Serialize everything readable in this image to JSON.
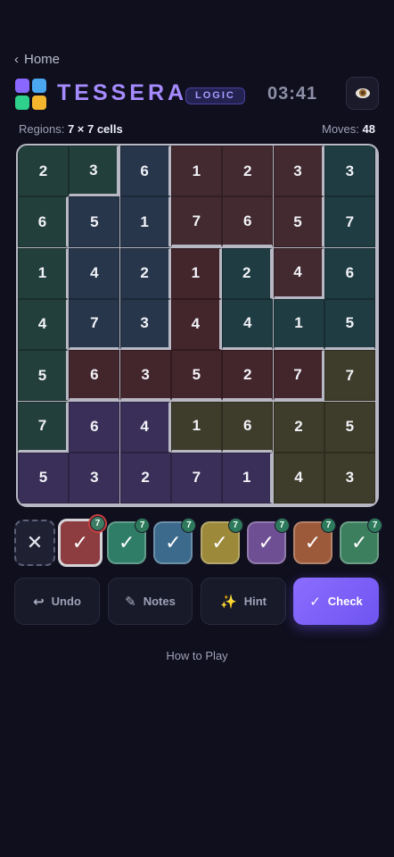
{
  "nav": {
    "back_label": "Home"
  },
  "header": {
    "title": "TESSERA",
    "badge": "LOGIC",
    "timer": "03:41"
  },
  "stats": {
    "regions_label": "Regions:",
    "regions_value": "7 × 7 cells",
    "moves_label": "Moves:",
    "moves_value": "48"
  },
  "colors": {
    "logo": [
      "#8a67ff",
      "#4aa7f0",
      "#2fcf8c",
      "#f3b62c"
    ],
    "regions": [
      "#233f3c",
      "#27364b",
      "#422a30",
      "#1e3c42",
      "#43252c",
      "#3e3c2a",
      "#3a2f58",
      "#4b2a33"
    ]
  },
  "board": {
    "grid": [
      [
        2,
        3,
        6,
        1,
        2,
        3,
        3
      ],
      [
        6,
        5,
        1,
        7,
        6,
        5,
        7
      ],
      [
        1,
        4,
        2,
        1,
        2,
        4,
        6
      ],
      [
        4,
        7,
        3,
        4,
        4,
        1,
        5
      ],
      [
        5,
        6,
        3,
        5,
        2,
        7,
        7
      ],
      [
        7,
        6,
        4,
        1,
        6,
        2,
        5
      ],
      [
        5,
        3,
        2,
        7,
        1,
        4,
        3
      ]
    ],
    "regions": [
      [
        0,
        0,
        1,
        2,
        2,
        2,
        3
      ],
      [
        0,
        1,
        1,
        2,
        2,
        2,
        3
      ],
      [
        0,
        1,
        1,
        4,
        3,
        2,
        3
      ],
      [
        0,
        1,
        1,
        4,
        3,
        3,
        3
      ],
      [
        0,
        4,
        4,
        4,
        4,
        4,
        5
      ],
      [
        0,
        6,
        6,
        5,
        5,
        5,
        5
      ],
      [
        6,
        6,
        6,
        6,
        6,
        5,
        5
      ]
    ]
  },
  "palette": {
    "clear_label": "✕",
    "swatches": [
      {
        "color": "#8d3c3f",
        "count": "7",
        "selected": true
      },
      {
        "color": "#2f7d66",
        "count": "7",
        "selected": false
      },
      {
        "color": "#3b6a8c",
        "count": "7",
        "selected": false
      },
      {
        "color": "#9c8a3a",
        "count": "7",
        "selected": false
      },
      {
        "color": "#6e4f93",
        "count": "7",
        "selected": false
      },
      {
        "color": "#9c5a3a",
        "count": "7",
        "selected": false
      },
      {
        "color": "#3c7f5f",
        "count": "7",
        "selected": false
      }
    ]
  },
  "actions": {
    "undo": "Undo",
    "notes": "Notes",
    "hint": "Hint",
    "check": "Check"
  },
  "footer": {
    "howto": "How to Play"
  }
}
